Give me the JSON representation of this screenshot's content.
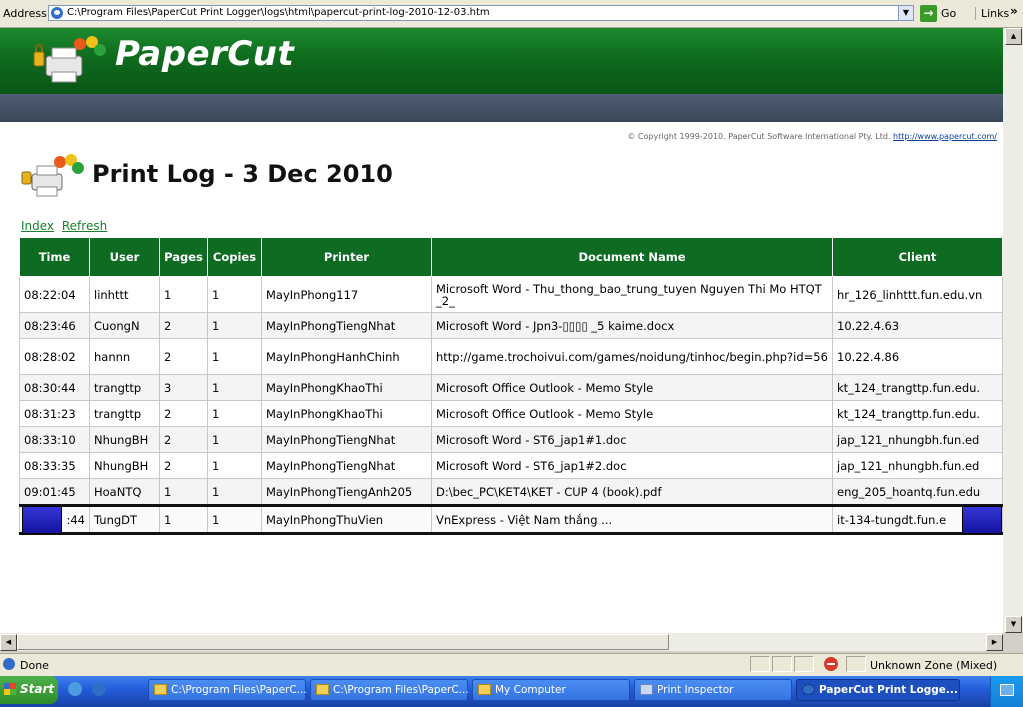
{
  "browser": {
    "address_label": "Address",
    "address_value": "C:\\Program Files\\PaperCut Print Logger\\logs\\html\\papercut-print-log-2010-12-03.htm",
    "go_label": "Go",
    "links_label": "Links",
    "status_text": "Done",
    "zone_text": "Unknown Zone (Mixed)"
  },
  "page": {
    "logo_text": "PaperCut",
    "copyright_text": "© Copyright 1999-2010. PaperCut Software International Pty. Ltd.",
    "copyright_link": "http://www.papercut.com/",
    "title": "Print Log - 3 Dec 2010",
    "links": [
      "Index",
      "Refresh"
    ]
  },
  "table": {
    "headers": [
      "Time",
      "User",
      "Pages",
      "Copies",
      "Printer",
      "Document Name",
      "Client"
    ],
    "rows": [
      [
        "08:22:04",
        "linhttt",
        "1",
        "1",
        "MayInPhong117",
        "Microsoft Word - Thu_thong_bao_trung_tuyen Nguyen Thi Mo HTQT _2_",
        "hr_126_linhttt.fun.edu.vn"
      ],
      [
        "08:23:46",
        "CuongN",
        "2",
        "1",
        "MayInPhongTiengNhat",
        "Microsoft Word - Jpn3-▯▯▯▯ _5 kaime.docx",
        "10.22.4.63"
      ],
      [
        "08:28:02",
        "hannn",
        "2",
        "1",
        "MayInPhongHanhChinh",
        "http://game.trochoivui.com/games/noidung/tinhoc/begin.php?id=56",
        "10.22.4.86"
      ],
      [
        "08:30:44",
        "trangttp",
        "3",
        "1",
        "MayInPhongKhaoThi",
        "Microsoft Office Outlook - Memo Style",
        "kt_124_trangttp.fun.edu."
      ],
      [
        "08:31:23",
        "trangttp",
        "2",
        "1",
        "MayInPhongKhaoThi",
        "Microsoft Office Outlook - Memo Style",
        "kt_124_trangttp.fun.edu."
      ],
      [
        "08:33:10",
        "NhungBH",
        "2",
        "1",
        "MayInPhongTiengNhat",
        "Microsoft Word - ST6_jap1#1.doc",
        "jap_121_nhungbh.fun.ed"
      ],
      [
        "08:33:35",
        "NhungBH",
        "2",
        "1",
        "MayInPhongTiengNhat",
        "Microsoft Word - ST6_jap1#2.doc",
        "jap_121_nhungbh.fun.ed"
      ],
      [
        "09:01:45",
        "HoaNTQ",
        "1",
        "1",
        "MayInPhongTiengAnh205",
        "D:\\bec_PC\\KET4\\KET - CUP 4 (book).pdf",
        "eng_205_hoantq.fun.edu"
      ],
      [
        ":44",
        "TungDT",
        "1",
        "1",
        "MayInPhongThuVien",
        "VnExpress - Việt Nam thắng ...",
        "it-134-tungdt.fun.e"
      ]
    ]
  },
  "taskbar": {
    "start_label": "Start",
    "tasks": [
      "C:\\Program Files\\PaperC...",
      "C:\\Program Files\\PaperC...",
      "My Computer",
      "Print Inspector",
      "PaperCut Print Logge..."
    ]
  },
  "colors": {
    "brand_green": "#0d6b22",
    "nav_strip": "#3a4658",
    "link_green": "#1a7f2e",
    "selection_blue": "#1414a0"
  },
  "icons": [
    "ie-icon",
    "go-arrow-icon",
    "papercut-logo-icon",
    "printer-people-icon",
    "security-zone-icon",
    "windows-flag-icon",
    "folder-icon"
  ]
}
